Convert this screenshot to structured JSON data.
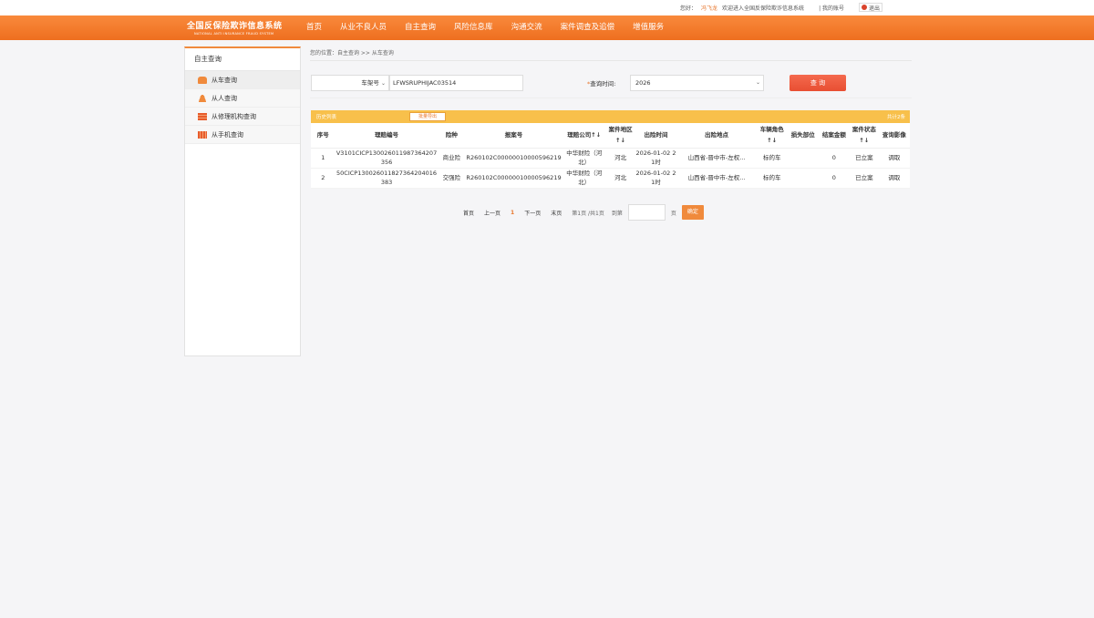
{
  "topbar": {
    "greeting": "您好：",
    "user_name": "冯飞龙",
    "welcome": "欢迎进入全国反保险欺诈信息系统",
    "my_account": "| 我的账号",
    "logout": "退出"
  },
  "logo": {
    "cn": "全国反保险欺诈信息系统",
    "en": "NATIONAL ANTI INSURANCE FRAUD SYSTEM"
  },
  "nav": {
    "items": [
      "首页",
      "从业不良人员",
      "自主查询",
      "风险信息库",
      "沟通交流",
      "案件调查及追偿",
      "增值服务"
    ]
  },
  "sidebar": {
    "title": "自主查询",
    "items": [
      {
        "label": "从车查询",
        "icon": "car-icon"
      },
      {
        "label": "从人查询",
        "icon": "person-icon"
      },
      {
        "label": "从修理机构查询",
        "icon": "repair-shop-icon"
      },
      {
        "label": "从手机查询",
        "icon": "phone-icon"
      }
    ]
  },
  "breadcrumb": "您的位置：自主查询 >> 从车查询",
  "search": {
    "type_value": "车架号",
    "vin_value": "LFWSRUPHIJAC03514",
    "time_label": "查询时间:",
    "time_value": "2026",
    "query_button": "查 询"
  },
  "results": {
    "title": "历史列表",
    "export_button": "批量导出",
    "total": "共计2条",
    "headers": [
      "序号",
      "理赔编号",
      "险种",
      "报案号",
      "理赔公司↑↓",
      "案件地区↑↓",
      "出险时间",
      "出险地点",
      "车辆角色↑↓",
      "损失部位",
      "结案金额",
      "案件状态↑↓",
      "查询影像"
    ],
    "rows": [
      [
        "1",
        "V3101CICP130026011987364207356",
        "商业险",
        "R260102C00000010000596219",
        "中华财险（河北）",
        "河北",
        "2026-01-02 21时",
        "山西省-晋中市-左权...",
        "标的车",
        "",
        "0",
        "已立案",
        "调取"
      ],
      [
        "2",
        "50CICP130026011827364204016383",
        "交强险",
        "R260102C00000010000596219",
        "中华财险（河北）",
        "河北",
        "2026-01-02 21时",
        "山西省-晋中市-左权...",
        "标的车",
        "",
        "0",
        "已立案",
        "调取"
      ]
    ]
  },
  "pager": {
    "first": "首页",
    "prev": "上一页",
    "current": "1",
    "next": "下一页",
    "last": "末页",
    "info": "第1页 /共1页",
    "goto": "到第",
    "page_unit": "页",
    "ok": "确定"
  },
  "colors": {
    "nav_orange": "#f07a2c",
    "query_red": "#e84e32",
    "result_bar": "#f8c04b"
  }
}
